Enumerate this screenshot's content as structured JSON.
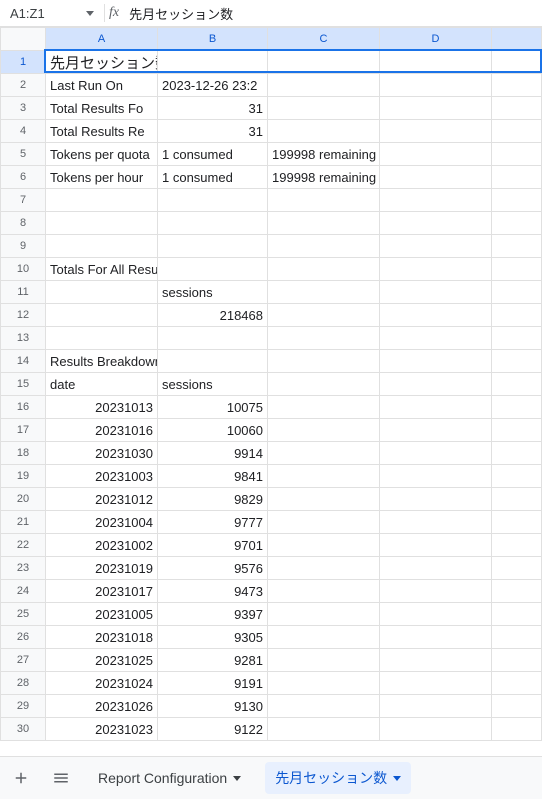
{
  "name_box": "A1:Z1",
  "formula_value": "先月セッション数",
  "columns": [
    "A",
    "B",
    "C",
    "D",
    ""
  ],
  "selected_row": 1,
  "title_row": {
    "a": "先月セッション数"
  },
  "meta_rows": [
    {
      "a": "Last Run On",
      "b": "2023-12-26 23:2",
      "c": "",
      "b_num": false
    },
    {
      "a": "Total Results Fo",
      "b": "31",
      "c": "",
      "b_num": true
    },
    {
      "a": "Total Results Re",
      "b": "31",
      "c": "",
      "b_num": true
    },
    {
      "a": "Tokens per quota",
      "b": "1 consumed",
      "c": "199998 remaining",
      "b_num": false
    },
    {
      "a": "Tokens per hour",
      "b": "1 consumed",
      "c": "199998 remaining",
      "b_num": false
    }
  ],
  "blank_rows_after_meta": 3,
  "totals_header": "Totals For All Results",
  "totals_cols": {
    "b": "sessions"
  },
  "totals_values": {
    "b": "218468"
  },
  "blank_row_after_totals": true,
  "breakdown_header": "Results Breakdown",
  "breakdown_cols": {
    "a": "date",
    "b": "sessions"
  },
  "breakdown_rows": [
    {
      "date": "20231013",
      "sessions": "10075"
    },
    {
      "date": "20231016",
      "sessions": "10060"
    },
    {
      "date": "20231030",
      "sessions": "9914"
    },
    {
      "date": "20231003",
      "sessions": "9841"
    },
    {
      "date": "20231012",
      "sessions": "9829"
    },
    {
      "date": "20231004",
      "sessions": "9777"
    },
    {
      "date": "20231002",
      "sessions": "9701"
    },
    {
      "date": "20231019",
      "sessions": "9576"
    },
    {
      "date": "20231017",
      "sessions": "9473"
    },
    {
      "date": "20231005",
      "sessions": "9397"
    },
    {
      "date": "20231018",
      "sessions": "9305"
    },
    {
      "date": "20231025",
      "sessions": "9281"
    },
    {
      "date": "20231024",
      "sessions": "9191"
    },
    {
      "date": "20231026",
      "sessions": "9130"
    },
    {
      "date": "20231023",
      "sessions": "9122"
    }
  ],
  "tabs": {
    "add_label": "+",
    "menu_label": "≡",
    "report_config": "Report Configuration",
    "active_tab": "先月セッション数"
  },
  "col_widths": {
    "rowhdr": 45,
    "A": 112,
    "B": 110,
    "C": 112,
    "D": 112,
    "E": 50
  }
}
